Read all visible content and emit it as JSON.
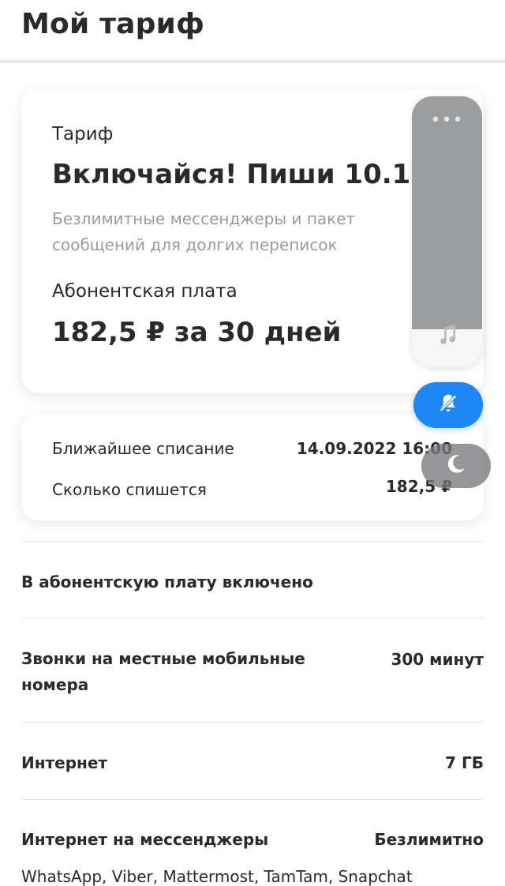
{
  "header": {
    "title": "Мой тариф"
  },
  "tariff_card": {
    "label": "Тариф",
    "name": "Включайся! Пиши 10.19",
    "description": "Безлимитные мессенджеры и пакет сообщений для долгих переписок",
    "fee_label": "Абонентская плата",
    "fee_value": "182,5 ₽ за 30 дней"
  },
  "charge_card": {
    "next_charge_label": "Ближайшее списание",
    "next_charge_value": "14.09.2022 16:00",
    "amount_label": "Сколько спишется",
    "amount_value": "182,5 ₽"
  },
  "included": {
    "heading": "В абонентскую плату включено",
    "items": [
      {
        "label": "Звонки на местные мобильные номера",
        "value": "300 минут"
      },
      {
        "label": "Интернет",
        "value": "7 ГБ"
      },
      {
        "label": "Интернет на мессенджеры",
        "value": "Безлимитно"
      }
    ],
    "cut_text": "WhatsApp, Viber, Mattermost, TamTam, Snapchat"
  },
  "overlay": {
    "volume_level": 0.86,
    "colors": {
      "accent": "#1f87f5",
      "fill": "#9c9d9f"
    },
    "icons": [
      "more-dots-icon",
      "music-note-icon",
      "bell-slash-icon",
      "moon-icon"
    ]
  }
}
